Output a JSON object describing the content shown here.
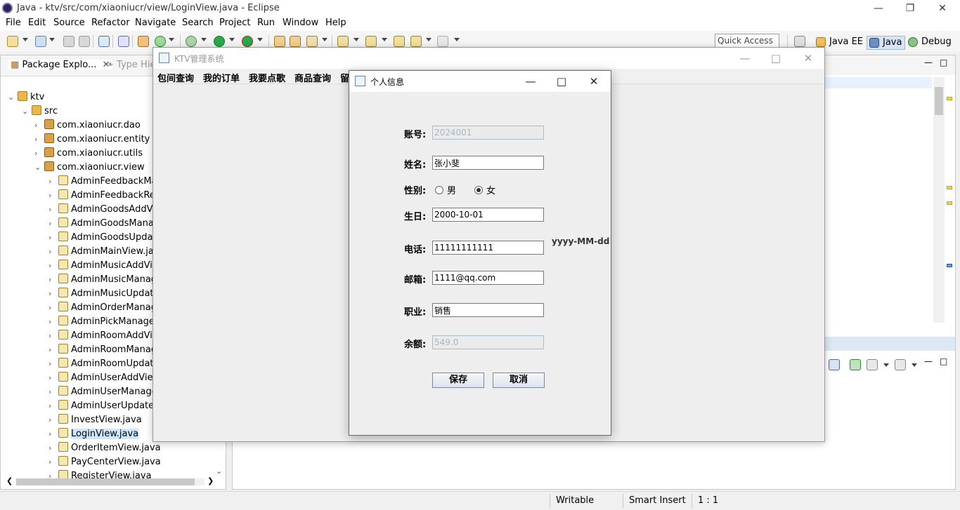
{
  "eclipse": {
    "title": "Java - ktv/src/com/xiaoniucr/view/LoginView.java - Eclipse",
    "menu": [
      "File",
      "Edit",
      "Source",
      "Refactor",
      "Navigate",
      "Search",
      "Project",
      "Run",
      "Window",
      "Help"
    ],
    "quick_access": "Quick Access",
    "perspectives": [
      "Java EE",
      "Java",
      "Debug"
    ],
    "status": {
      "writable": "Writable",
      "insert_mode": "Smart Insert",
      "position": "1 : 1"
    }
  },
  "package_explorer": {
    "tab_label": "Package Explo...",
    "tab2_label": "Type Hie",
    "tree": [
      {
        "label": "ktv",
        "twist": "⌄"
      },
      {
        "label": "src",
        "twist": "⌄"
      },
      {
        "label": "com.xiaoniucr.dao",
        "twist": "›"
      },
      {
        "label": "com.xiaoniucr.entity",
        "twist": "›"
      },
      {
        "label": "com.xiaoniucr.utils",
        "twist": "›"
      },
      {
        "label": "com.xiaoniucr.view",
        "twist": "⌄"
      },
      {
        "label": "AdminFeedbackMa",
        "twist": "›"
      },
      {
        "label": "AdminFeedbackRep",
        "twist": "›"
      },
      {
        "label": "AdminGoodsAddVi",
        "twist": "›"
      },
      {
        "label": "AdminGoodsManag",
        "twist": "›"
      },
      {
        "label": "AdminGoodsUpdat",
        "twist": "›"
      },
      {
        "label": "AdminMainView.jav",
        "twist": "›"
      },
      {
        "label": "AdminMusicAddVie",
        "twist": "›"
      },
      {
        "label": "AdminMusicManag",
        "twist": "›"
      },
      {
        "label": "AdminMusicUpdate",
        "twist": "›"
      },
      {
        "label": "AdminOrderManag",
        "twist": "›"
      },
      {
        "label": "AdminPickManageV",
        "twist": "›"
      },
      {
        "label": "AdminRoomAddVie",
        "twist": "›"
      },
      {
        "label": "AdminRoomManag",
        "twist": "›"
      },
      {
        "label": "AdminRoomUpdate",
        "twist": "›"
      },
      {
        "label": "AdminUserAddView",
        "twist": "›"
      },
      {
        "label": "AdminUserManage",
        "twist": "›"
      },
      {
        "label": "AdminUserUpdateV",
        "twist": "›"
      },
      {
        "label": "InvestView.java",
        "twist": "›"
      },
      {
        "label": "LoginView.java",
        "twist": "›"
      },
      {
        "label": "OrderItemView.java",
        "twist": "›"
      },
      {
        "label": "PayCenterView.java",
        "twist": "›"
      },
      {
        "label": "RegisterView.java",
        "twist": "›"
      }
    ]
  },
  "ktv_window": {
    "title": "KTV管理系统",
    "menu": [
      "包间查询",
      "我的订单",
      "我要点歌",
      "商品查询",
      "留"
    ]
  },
  "dialog": {
    "title": "个人信息",
    "account_label": "账号:",
    "account_value": "2024001",
    "name_label": "姓名:",
    "name_value": "张小斐",
    "gender_label": "性别:",
    "gender_male": "男",
    "gender_female": "女",
    "gender_selected": "女",
    "birthday_label": "生日:",
    "birthday_value": "2000-10-01",
    "birthday_hint": "yyyy-MM-dd",
    "phone_label": "电话:",
    "phone_value": "11111111111",
    "email_label": "邮箱:",
    "email_value": "1111@qq.com",
    "job_label": "职业:",
    "job_value": "销售",
    "balance_label": "余额:",
    "balance_value": "549.0",
    "save_button": "保存",
    "cancel_button": "取消"
  }
}
